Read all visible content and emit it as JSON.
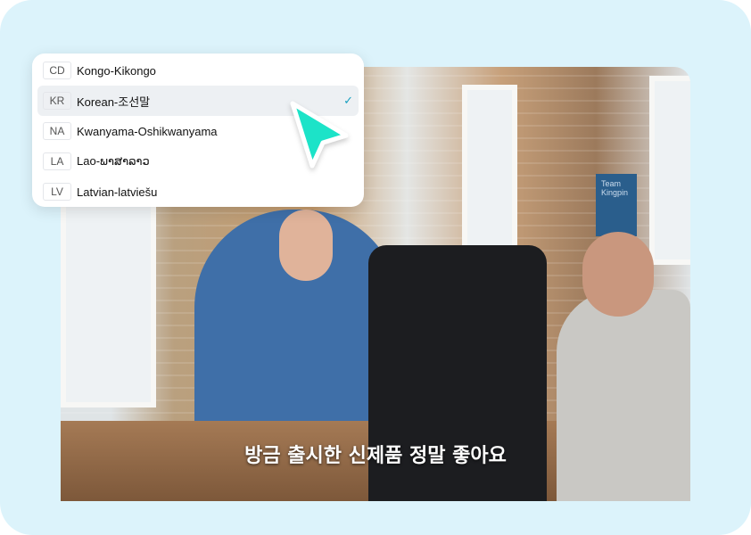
{
  "languages": [
    {
      "code": "CD",
      "label": "Kongo-Kikongo",
      "selected": false
    },
    {
      "code": "KR",
      "label": "Korean-조선말",
      "selected": true
    },
    {
      "code": "NA",
      "label": "Kwanyama-Oshikwanyama",
      "selected": false
    },
    {
      "code": "LA",
      "label": "Lao-ພາສາລາວ",
      "selected": false
    },
    {
      "code": "LV",
      "label": "Latvian-latviešu",
      "selected": false
    }
  ],
  "check_icon": "✓",
  "subtitle": "방금 출시한 신제품 정말 좋아요",
  "sign_text": "Team Kingpin",
  "colors": {
    "background": "#dcf3fb",
    "cursor": "#1de3c8",
    "check": "#1aa0c0"
  }
}
